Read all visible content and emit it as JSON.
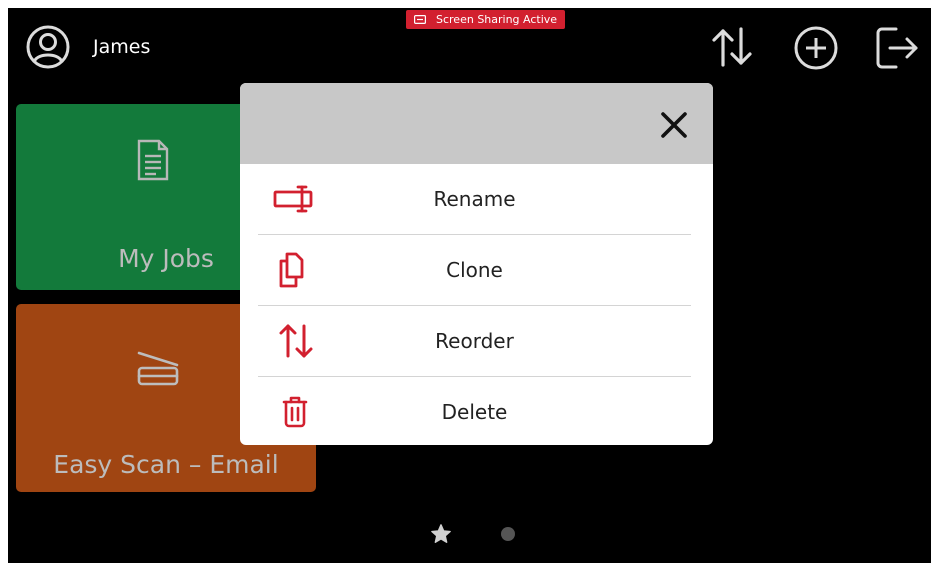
{
  "header": {
    "user_name": "James",
    "share_badge": "Screen Sharing Active",
    "icons": [
      "reorder-arrows-icon",
      "add-circle-icon",
      "logout-icon"
    ]
  },
  "tiles": [
    {
      "label": "My Jobs",
      "icon": "document-icon",
      "color": "#137a3b"
    },
    {
      "label": "Easy Scan – Email",
      "icon": "scanner-icon",
      "color": "#a04512"
    }
  ],
  "dialog": {
    "close_icon": "close-icon",
    "items": [
      {
        "label": "Rename",
        "icon": "rename-icon"
      },
      {
        "label": "Clone",
        "icon": "clone-icon"
      },
      {
        "label": "Reorder",
        "icon": "reorder-icon"
      },
      {
        "label": "Delete",
        "icon": "trash-icon"
      }
    ],
    "accent_color": "#d2202f"
  },
  "pagination": {
    "pages": 2,
    "current": 1
  }
}
